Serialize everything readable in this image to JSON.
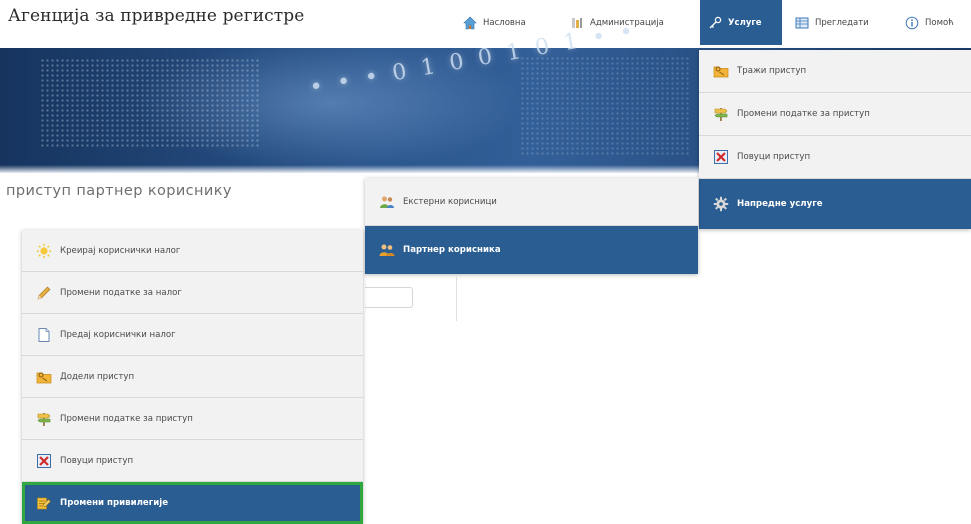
{
  "header": {
    "site_title": "Агенција за привредне регистре",
    "nav": [
      {
        "label": "Насловна",
        "icon": "home-icon"
      },
      {
        "label": "Администрација",
        "icon": "tools-icon"
      },
      {
        "label": "Услуге",
        "icon": "key-icon",
        "active": true
      },
      {
        "label": "Прегледати",
        "icon": "table-icon"
      },
      {
        "label": "Помоћ",
        "icon": "info-icon"
      }
    ]
  },
  "banner": {
    "binary_text": "• • • 0 1 0 0 1 0 1 • •"
  },
  "page": {
    "heading": "приступ партнер кориснику"
  },
  "menus": {
    "right": [
      {
        "label": "Тражи приступ",
        "icon": "folder-key-icon"
      },
      {
        "label": "Промени податке за приступ",
        "icon": "signpost-icon"
      },
      {
        "label": "Повуци приступ",
        "icon": "revoke-x-icon"
      },
      {
        "label": "Напредне услуге",
        "icon": "gear-icon",
        "selected": true
      }
    ],
    "middle": [
      {
        "label": "Екстерни корисници",
        "icon": "users-icon"
      },
      {
        "label": "Партнер корисника",
        "icon": "partner-users-icon",
        "selected": true
      }
    ],
    "left": [
      {
        "label": "Креирај кориснички налог",
        "icon": "sun-icon"
      },
      {
        "label": "Промени податке за налог",
        "icon": "pencil-icon"
      },
      {
        "label": "Предај кориснички налог",
        "icon": "document-icon"
      },
      {
        "label": "Додели приступ",
        "icon": "folder-key-icon"
      },
      {
        "label": "Промени податке за приступ",
        "icon": "signpost-icon"
      },
      {
        "label": "Повуци приступ",
        "icon": "revoke-x-icon"
      },
      {
        "label": "Промени привилегије",
        "icon": "privileges-icon",
        "selected": true,
        "highlighted": true
      }
    ]
  },
  "colors": {
    "menu_selected_bg": "#2a5d92",
    "highlight_border": "#2fa83f",
    "banner_dark": "#16345e"
  }
}
